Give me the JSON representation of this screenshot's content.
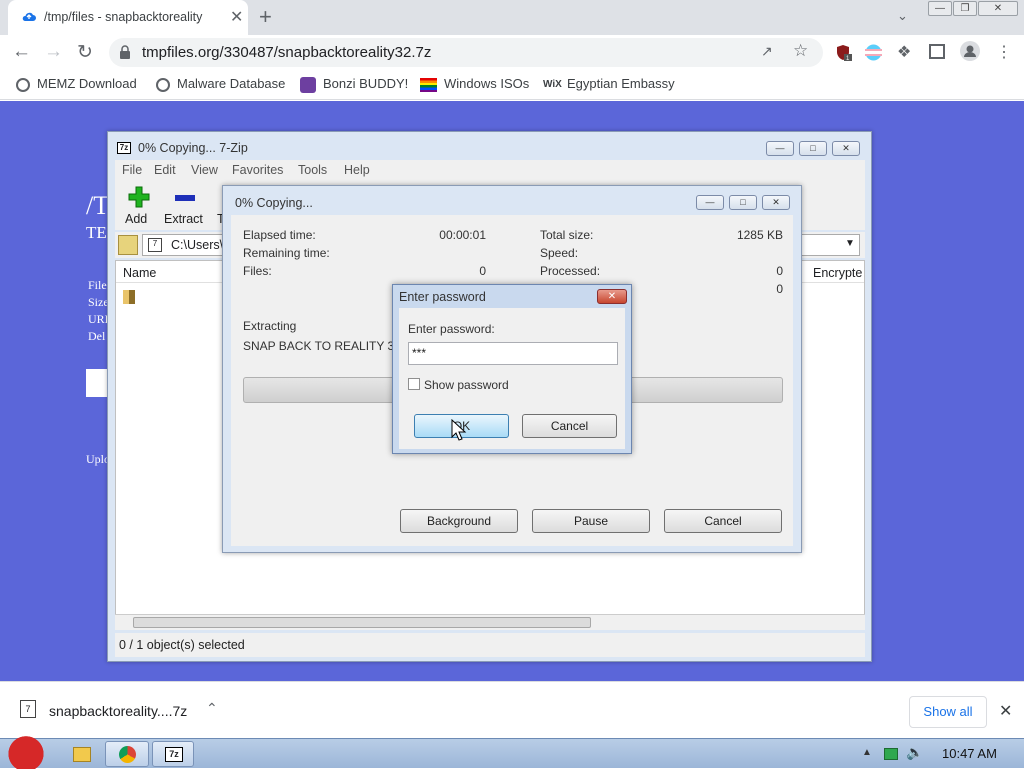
{
  "browser": {
    "tab_title": "/tmp/files - snapbacktoreality",
    "tab_close": "✕",
    "new_tab": "+",
    "url": "tmpfiles.org/330487/snapbacktoreality32.7z",
    "accent": "#1a73e8"
  },
  "bookmarks": [
    {
      "label": "MEMZ Download",
      "icon": "globe-icon"
    },
    {
      "label": "Malware Database",
      "icon": "globe-icon"
    },
    {
      "label": "Bonzi BUDDY!",
      "icon": "bonzi-icon"
    },
    {
      "label": "Windows ISOs",
      "icon": "rainbow-flag-icon"
    },
    {
      "label": "Egyptian Embassy",
      "icon": "wix-icon"
    }
  ],
  "page": {
    "frag_title": "/T",
    "frag_sub": "TE",
    "frag_lines": [
      "File",
      "Size",
      "URL",
      "Del"
    ],
    "frag_upload": "Uplo",
    "bg": "#5b66d9"
  },
  "zip": {
    "title": "0% Copying... 7-Zip",
    "menu": [
      "File",
      "Edit",
      "View",
      "Favorites",
      "Tools",
      "Help"
    ],
    "tools": [
      "Add",
      "Extract",
      "T"
    ],
    "address": "C:\\Users\\",
    "columns": [
      "Name",
      "Encrypte"
    ],
    "status": "0 / 1 object(s) selected"
  },
  "copy": {
    "title": "0% Copying...",
    "elapsed_label": "Elapsed time:",
    "elapsed_value": "00:00:01",
    "remaining_label": "Remaining time:",
    "files_label": "Files:",
    "files_value": "0",
    "total_label": "Total size:",
    "total_value": "1285 KB",
    "speed_label": "Speed:",
    "processed_label": "Processed:",
    "processed_value": "0",
    "extra_value": "0",
    "extracting_label": "Extracting",
    "item": "SNAP BACK TO REALITY 32",
    "progress": 0,
    "buttons": {
      "background": "Background",
      "pause": "Pause",
      "cancel": "Cancel"
    }
  },
  "password": {
    "title": "Enter password",
    "label": "Enter password:",
    "value": "***",
    "show_label": "Show password",
    "ok": "OK",
    "cancel": "Cancel"
  },
  "download": {
    "filename": "snapbacktoreality....7z",
    "show_all": "Show all"
  },
  "taskbar": {
    "clock": "10:47 AM"
  }
}
